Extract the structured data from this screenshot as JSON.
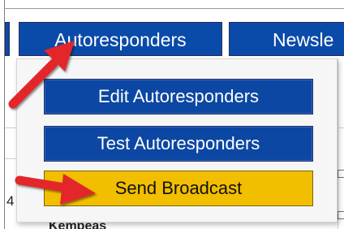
{
  "nav": {
    "tabs": [
      {
        "label": "Autoresponders"
      },
      {
        "label": "Newsle"
      }
    ]
  },
  "dropdown": {
    "items": [
      {
        "label": "Edit Autoresponders"
      },
      {
        "label": "Test Autoresponders"
      },
      {
        "label": "Send Broadcast"
      }
    ]
  },
  "background": {
    "fragment_a": "4",
    "fragment_b": "Kempeas"
  },
  "colors": {
    "menu_blue": "#0b47a3",
    "menu_highlight": "#f2be00",
    "arrow_red": "#e3262a"
  },
  "icons": [
    "arrow-pointer-icon"
  ]
}
